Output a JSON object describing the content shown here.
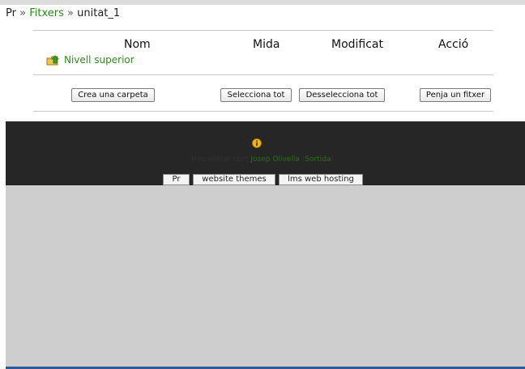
{
  "breadcrumb": {
    "root": "Pr",
    "sep1": "»",
    "folder": "Fitxers",
    "sep2": "»",
    "current": "unitat_1"
  },
  "table": {
    "headers": {
      "name": "Nom",
      "size": "Mida",
      "modified": "Modificat",
      "action": "Acció"
    },
    "parent_link": "Nivell superior"
  },
  "buttons": {
    "create_folder": "Crea una carpeta",
    "select_all": "Selecciona tot",
    "deselect_all": "Desselecciona tot",
    "upload": "Penja un fitxer"
  },
  "footer": {
    "info_icon": "info-icon",
    "logged_in_as": "Heu entrat com",
    "user_name": "Josep Olivella",
    "logout_open": "(",
    "logout": "Sortida",
    "logout_close": ")",
    "links": [
      "Pr",
      "website themes",
      "lms web hosting"
    ]
  },
  "colors": {
    "link_green": "#2f8a1e",
    "footer_bg": "#262626",
    "grey_area": "#cecece",
    "bottom_bar": "#2a5a9a"
  }
}
